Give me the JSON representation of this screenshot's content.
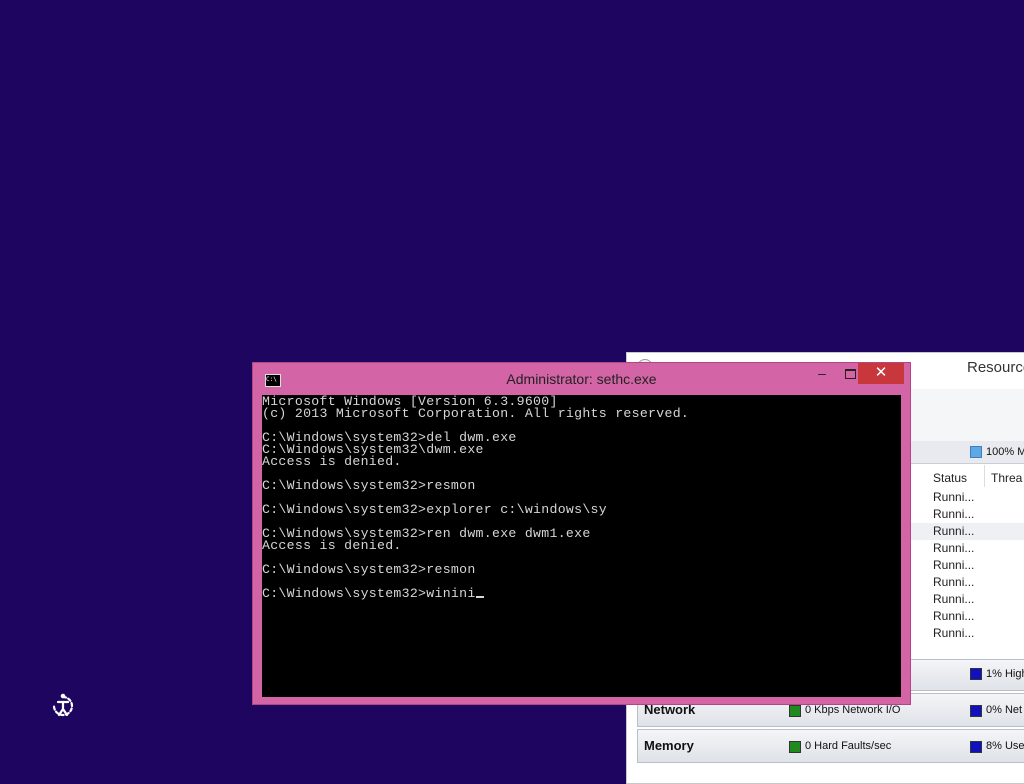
{
  "resource_monitor": {
    "title": "Resource",
    "cpu_header": "100% M",
    "columns": {
      "status": "Status",
      "threads": "Threa"
    },
    "rows": [
      {
        "status": "Runni...",
        "thr": ""
      },
      {
        "status": "Runni...",
        "thr": ""
      },
      {
        "status": "Runni...",
        "thr": ""
      },
      {
        "status": "Runni...",
        "thr": ""
      },
      {
        "status": "Runni...",
        "thr": ""
      },
      {
        "status": "Runni...",
        "thr": ""
      },
      {
        "status": "Runni...",
        "thr": ""
      },
      {
        "status": "Runni...",
        "thr": ""
      },
      {
        "status": "Runni...",
        "thr": ""
      }
    ],
    "disk": {
      "right": "1% High"
    },
    "network": {
      "name": "Network",
      "middle": "0 Kbps Network I/O",
      "right": "0% Net"
    },
    "memory": {
      "name": "Memory",
      "middle": "0 Hard Faults/sec",
      "right": "8% Use"
    },
    "colors": {
      "green": "#1f8a1f",
      "blue": "#1010c0",
      "cpu": "#5fa8e6"
    }
  },
  "cmd": {
    "title": "Administrator: sethc.exe",
    "close_glyph": "✕",
    "min_glyph": "‒",
    "lines": [
      "Microsoft Windows [Version 6.3.9600]",
      "(c) 2013 Microsoft Corporation. All rights reserved.",
      "",
      "C:\\Windows\\system32>del dwm.exe",
      "C:\\Windows\\system32\\dwm.exe",
      "Access is denied.",
      "",
      "C:\\Windows\\system32>resmon",
      "",
      "C:\\Windows\\system32>explorer c:\\windows\\sy",
      "",
      "C:\\Windows\\system32>ren dwm.exe dwm1.exe",
      "Access is denied.",
      "",
      "C:\\Windows\\system32>resmon",
      "",
      "C:\\Windows\\system32>winini"
    ],
    "colors": {
      "frame": "#d364a6",
      "console_bg": "#000000",
      "console_text": "#d6d6d6",
      "close_bg": "#c7373b"
    }
  },
  "desktop": {
    "background": "#1e0660",
    "ease_icon": "ease-of-access-icon"
  }
}
